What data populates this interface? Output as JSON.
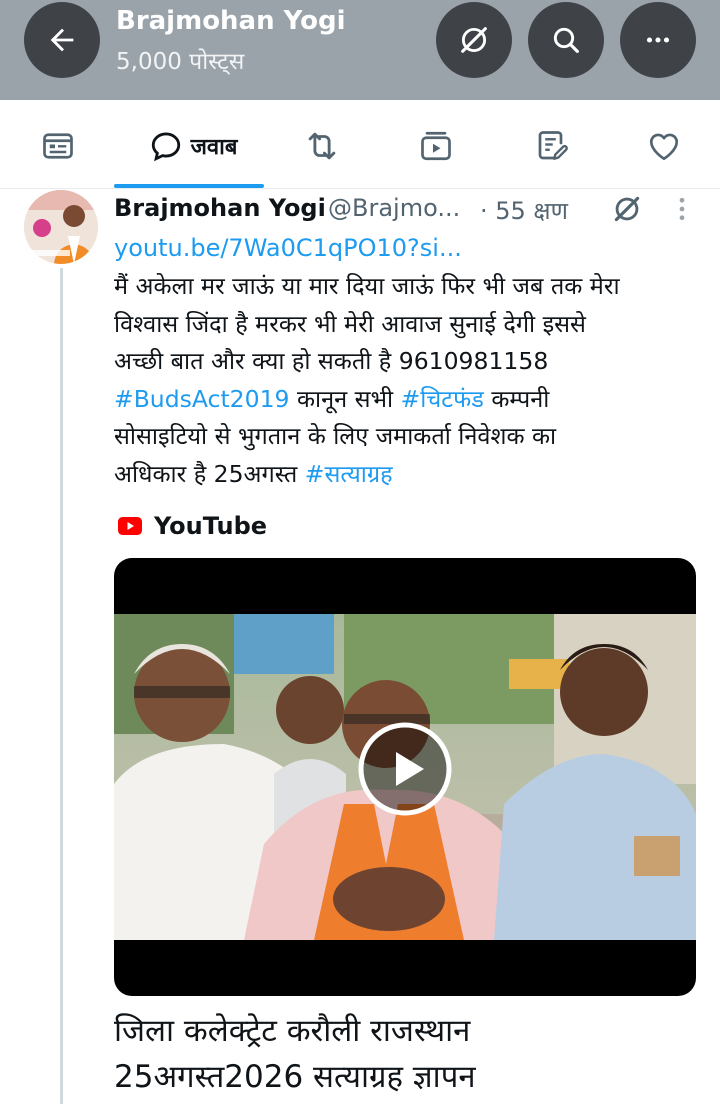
{
  "header": {
    "title": "Brajmohan Yogi",
    "subtitle": "5,000 पोस्ट्स"
  },
  "tabs": [
    {
      "icon": "posts-icon",
      "label": ""
    },
    {
      "icon": "reply-bubble-icon",
      "label": "जवाब",
      "selected": true
    },
    {
      "icon": "retweet-icon",
      "label": ""
    },
    {
      "icon": "media-video-icon",
      "label": ""
    },
    {
      "icon": "articles-icon",
      "label": ""
    },
    {
      "icon": "heart-icon",
      "label": ""
    }
  ],
  "post": {
    "name": "Brajmohan Yogi",
    "handle": "@Brajmo...",
    "time": "· 55 क्षण",
    "link": "youtu.be/7Wa0C1qPO10?si...",
    "lines": [
      {
        "pre": "मैं अकेला मर जाऊं या मार दिया जाऊं फिर भी जब तक मेरा"
      },
      {
        "pre": "विश्वास जिंदा है मरकर भी मेरी आवाज सुनाई देगी इससे"
      },
      {
        "pre": "अच्छी बात और क्या हो सकती है 9610981158"
      },
      {
        "tag1": "#BudsAct2019",
        "mid": " कानून सभी ",
        "tag2": "#चिटफंड",
        "post": " कम्पनी"
      },
      {
        "pre": "सोसाइटियो से भुगतान के लिए जमाकर्ता निवेशक का"
      },
      {
        "pre": "अधिकार है 25अगस्त ",
        "tag": "#सत्याग्रह"
      }
    ],
    "card_source": "YouTube",
    "card_title_lines": [
      "जिला कलेक्ट्रेट करौली राजस्थान",
      "25अगस्त2026 सत्याग्रह ज्ञापन"
    ]
  },
  "colors": {
    "accent": "#1d9bf0",
    "header_bg": "#9aa3aa",
    "header_button": "#3f4348",
    "youtube_red": "#ff0000"
  }
}
